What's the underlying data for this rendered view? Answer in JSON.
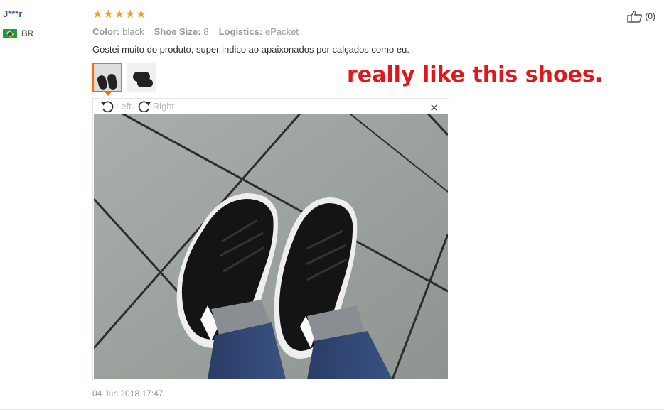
{
  "review": {
    "user_name": "J***r",
    "country": "BR",
    "rating": 5,
    "attributes": [
      {
        "key": "Color:",
        "value": "black"
      },
      {
        "key": "Shoe Size:",
        "value": "8"
      },
      {
        "key": "Logistics:",
        "value": "ePacket"
      }
    ],
    "feedback_text": "Gostei muito do produto, super indico ao apaixonados por calçados como eu.",
    "like_count": "(0)",
    "date": "04 Jun 2018 17:47"
  },
  "viewer": {
    "rotate_left_label": "Left",
    "rotate_right_label": "Right"
  },
  "annotation": {
    "text": "really like this shoes."
  },
  "colors": {
    "star": "#f7a21b",
    "accent": "#ff6a00",
    "annotation": "#e0161b",
    "user_link": "#2d5aa0"
  }
}
